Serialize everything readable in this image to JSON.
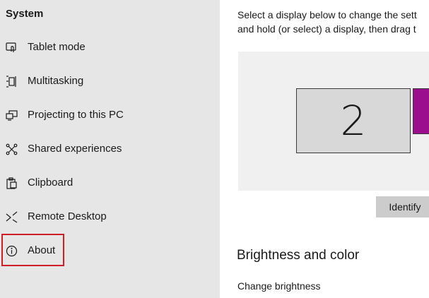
{
  "sidebar": {
    "title": "System",
    "items": [
      {
        "label": "Tablet mode",
        "icon": "tablet-mode-icon"
      },
      {
        "label": "Multitasking",
        "icon": "multitasking-icon"
      },
      {
        "label": "Projecting to this PC",
        "icon": "projecting-icon"
      },
      {
        "label": "Shared experiences",
        "icon": "shared-experiences-icon"
      },
      {
        "label": "Clipboard",
        "icon": "clipboard-icon"
      },
      {
        "label": "Remote Desktop",
        "icon": "remote-desktop-icon"
      },
      {
        "label": "About",
        "icon": "info-icon"
      }
    ]
  },
  "main": {
    "intro_line1": "Select a display below to change the sett",
    "intro_line2": "and hold (or select) a display, then drag t",
    "display_2_number": "2",
    "identify_button": "Identify",
    "section_heading": "Brightness and color",
    "change_brightness_label": "Change brightness"
  },
  "colors": {
    "sidebar_bg": "#e6e6e6",
    "highlight_border": "#d01e28",
    "display_1": "#9b0f8f",
    "display_2": "#d8d8d8"
  }
}
